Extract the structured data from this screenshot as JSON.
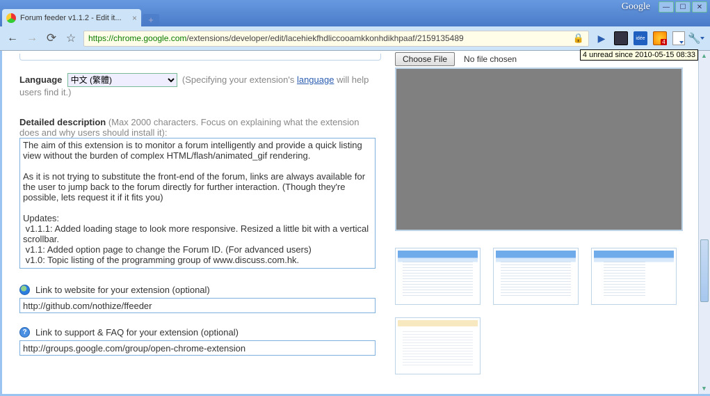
{
  "browser": {
    "tab_title": "Forum feeder v1.1.2 - Edit it...",
    "url_secure": "https",
    "url_host": "://chrome.google.com",
    "url_path": "/extensions/developer/edit/lacehiekfhdliccooamkkonhdikhpaaf/2159135489",
    "google_label": "Google",
    "idee_label": "idée"
  },
  "labels": {
    "language": "Language",
    "lang_helper_pre": "(Specifying your extension's ",
    "lang_link": "language",
    "lang_helper_post": " will help users find it.)",
    "detailed": "Detailed description",
    "detailed_hint": " (Max 2000 characters. Focus on explaining what the extension does and why users should install it):",
    "website": "Link to website for your extension (optional)",
    "support": "Link to support & FAQ for your extension (optional)",
    "choose_file": "Choose File",
    "no_file": "No file chosen"
  },
  "form": {
    "language_value": "中文 (繁體)",
    "description": "The aim of this extension is to monitor a forum intelligently and provide a quick listing view without the burden of complex HTML/flash/animated_gif rendering.\n\nAs it is not trying to substitute the front-end of the forum, links are always available for the user to jump back to the forum directly for further interaction. (Though they're possible, lets request it if it fits you)\n\nUpdates:\n v1.1.1: Added loading stage to look more responsive. Resized a little bit with a vertical scrollbar.\n v1.1: Added option page to change the Forum ID. (For advanced users)\n v1.0: Topic listing of the programming group of www.discuss.com.hk.",
    "website_url": "http://github.com/nothize/ffeeder",
    "support_url": "http://groups.google.com/group/open-chrome-extension"
  },
  "tooltip": "4 unread since 2010-05-15 08:33"
}
